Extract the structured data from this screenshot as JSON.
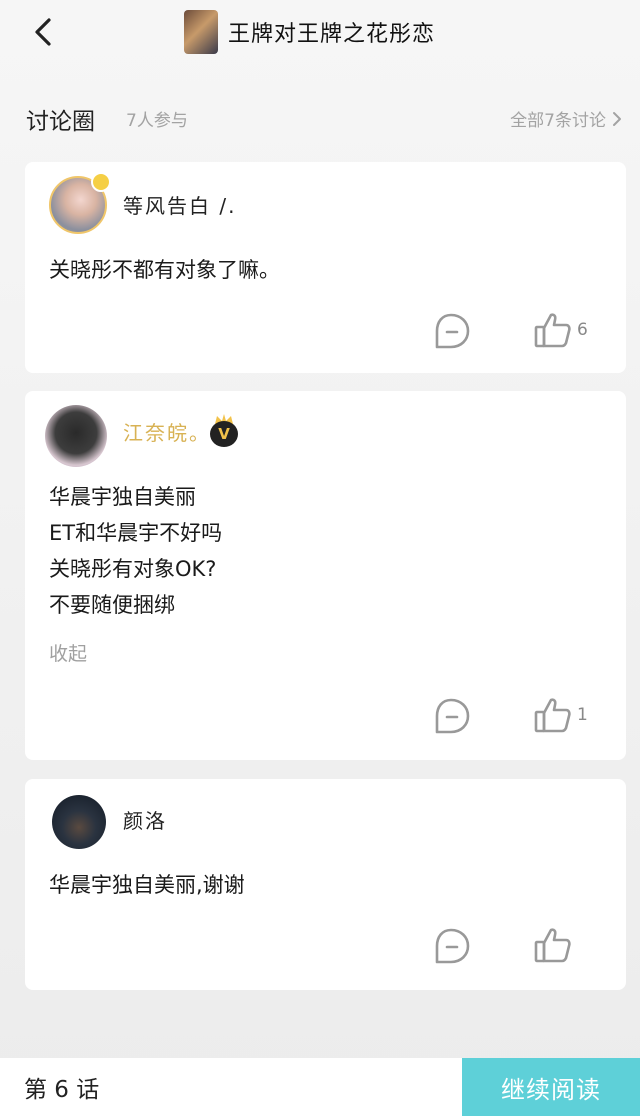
{
  "header": {
    "title": "王牌对王牌之花彤恋"
  },
  "section": {
    "title": "讨论圈",
    "count": "7人参与",
    "all_link": "全部7条讨论"
  },
  "comments": [
    {
      "user": "等风告白 /.",
      "vip": false,
      "lines": [
        "关晓彤不都有对象了嘛。"
      ],
      "like_count": "6"
    },
    {
      "user": "江奈皖。",
      "vip": true,
      "vip_badge": "V",
      "lines": [
        "华晨宇独自美丽",
        "ET和华晨宇不好吗",
        "关晓彤有对象OK?",
        "不要随便捆绑"
      ],
      "collapse_label": "收起",
      "like_count": "1"
    },
    {
      "user": "颜洛",
      "vip": false,
      "lines": [
        "华晨宇独自美丽,谢谢"
      ],
      "like_count": ""
    }
  ],
  "bottom": {
    "chapter": "第 6 话",
    "continue_label": "继续阅读"
  },
  "colors": {
    "accent": "#5ed0d8",
    "vip_name": "#d8b254",
    "muted": "#a3a3a3"
  },
  "icons": [
    "back-arrow-icon",
    "chevron-right-icon",
    "comment-icon",
    "thumbs-up-icon",
    "crown-icon",
    "vip-badge-icon"
  ]
}
